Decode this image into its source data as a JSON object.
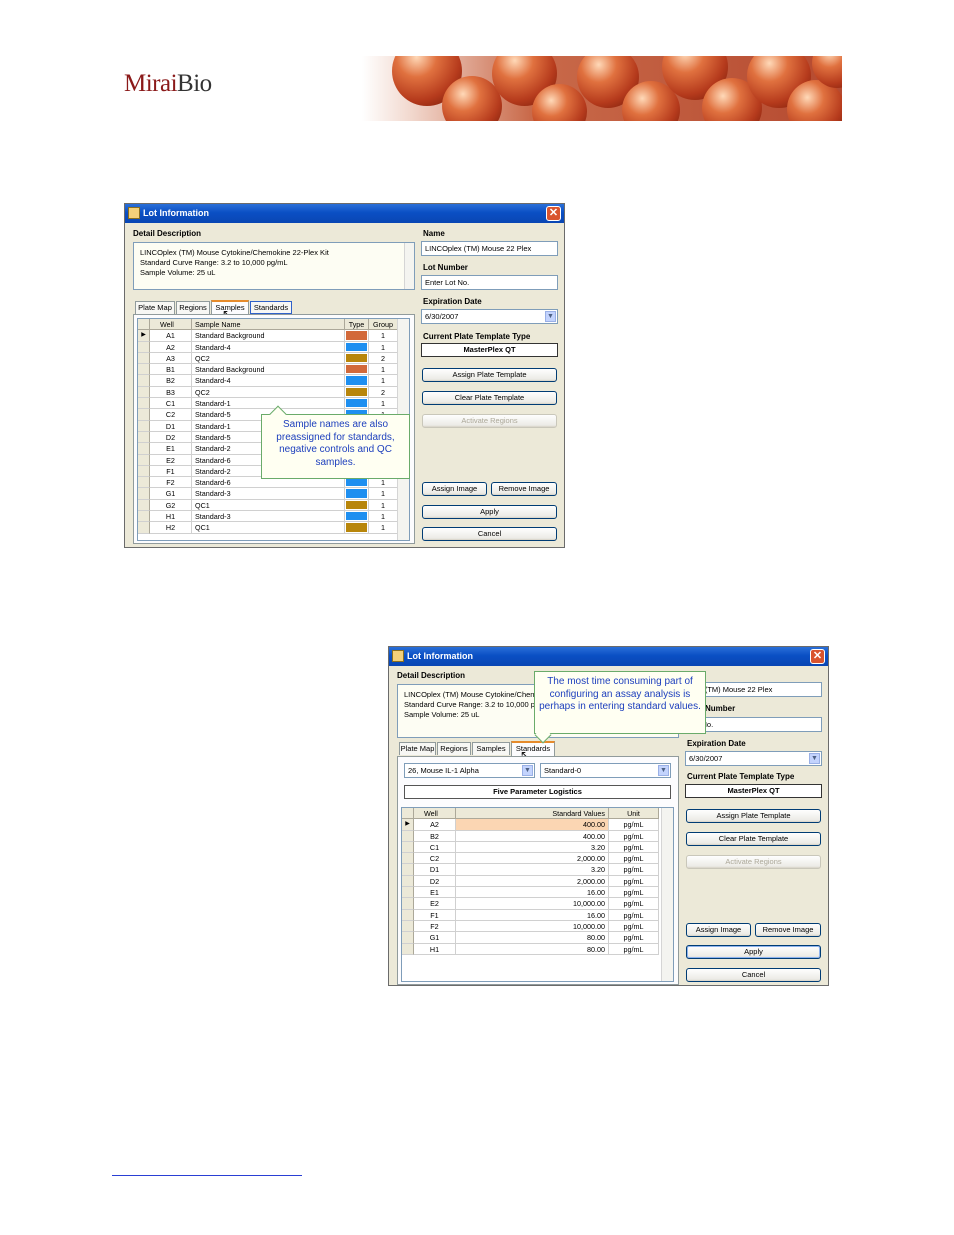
{
  "header": {
    "logo_mirai": "Mirai",
    "logo_bio": "Bio"
  },
  "dialog1": {
    "title": "Lot Information",
    "detail_label": "Detail Description",
    "description_lines": [
      "LINCOplex (TM) Mouse Cytokine/Chemokine 22-Plex Kit",
      "Standard Curve Range: 3.2 to 10,000 pg/mL",
      "Sample Volume: 25 uL"
    ],
    "tabs": [
      "Plate Map",
      "Regions",
      "Samples",
      "Standards"
    ],
    "active_tab": "Samples",
    "columns": [
      "Well",
      "Sample Name",
      "Type",
      "Group"
    ],
    "rows": [
      {
        "well": "A1",
        "name": "Standard Background",
        "color": "#d2693a",
        "group": "1"
      },
      {
        "well": "A2",
        "name": "Standard-4",
        "color": "#1e8ff0",
        "group": "1"
      },
      {
        "well": "A3",
        "name": "QC2",
        "color": "#b8860b",
        "group": "2"
      },
      {
        "well": "B1",
        "name": "Standard Background",
        "color": "#d2693a",
        "group": "1"
      },
      {
        "well": "B2",
        "name": "Standard-4",
        "color": "#1e8ff0",
        "group": "1"
      },
      {
        "well": "B3",
        "name": "QC2",
        "color": "#b8860b",
        "group": "2"
      },
      {
        "well": "C1",
        "name": "Standard-1",
        "color": "#1e8ff0",
        "group": "1"
      },
      {
        "well": "C2",
        "name": "Standard-5",
        "color": "#1e8ff0",
        "group": "1"
      },
      {
        "well": "D1",
        "name": "Standard-1",
        "color": "#1e8ff0",
        "group": "1"
      },
      {
        "well": "D2",
        "name": "Standard-5",
        "color": "#1e8ff0",
        "group": "1"
      },
      {
        "well": "E1",
        "name": "Standard-2",
        "color": "#1e8ff0",
        "group": "1"
      },
      {
        "well": "E2",
        "name": "Standard-6",
        "color": "#1e8ff0",
        "group": "1"
      },
      {
        "well": "F1",
        "name": "Standard-2",
        "color": "#1e8ff0",
        "group": "1"
      },
      {
        "well": "F2",
        "name": "Standard-6",
        "color": "#1e8ff0",
        "group": "1"
      },
      {
        "well": "G1",
        "name": "Standard-3",
        "color": "#1e8ff0",
        "group": "1"
      },
      {
        "well": "G2",
        "name": "QC1",
        "color": "#b8860b",
        "group": "1"
      },
      {
        "well": "H1",
        "name": "Standard-3",
        "color": "#1e8ff0",
        "group": "1"
      },
      {
        "well": "H2",
        "name": "QC1",
        "color": "#b8860b",
        "group": "1"
      }
    ],
    "name_label": "Name",
    "name_value": "LINCOplex (TM) Mouse 22 Plex",
    "lot_label": "Lot Number",
    "lot_value": "Enter Lot No.",
    "exp_label": "Expiration Date",
    "exp_value": "6/30/2007",
    "tpl_label": "Current Plate Template Type",
    "tpl_value": "MasterPlex QT",
    "btn_assign_tpl": "Assign Plate Template",
    "btn_clear_tpl": "Clear Plate Template",
    "btn_activate": "Activate Regions",
    "btn_assign_img": "Assign Image",
    "btn_remove_img": "Remove Image",
    "btn_apply": "Apply",
    "btn_cancel": "Cancel",
    "callout": "Sample names are also preassigned for standards, negative controls and QC samples."
  },
  "dialog2": {
    "title": "Lot Information",
    "detail_label": "Detail Description",
    "description_lines": [
      "LINCOplex (TM) Mouse Cytokine/Chem",
      "Standard Curve Range: 3.2 to 10,000 p",
      "Sample Volume: 25 uL"
    ],
    "tabs": [
      "Plate Map",
      "Regions",
      "Samples",
      "Standards"
    ],
    "active_tab": "Standards",
    "analyte_value": "26, Mouse IL-1 Alpha",
    "standard_value": "Standard-0",
    "curve_value": "Five Parameter Logistics",
    "columns": [
      "Well",
      "Standard Values",
      "Unit"
    ],
    "rows": [
      {
        "well": "A2",
        "value": "400.00",
        "unit": "pg/mL"
      },
      {
        "well": "B2",
        "value": "400.00",
        "unit": "pg/mL"
      },
      {
        "well": "C1",
        "value": "3.20",
        "unit": "pg/mL"
      },
      {
        "well": "C2",
        "value": "2,000.00",
        "unit": "pg/mL"
      },
      {
        "well": "D1",
        "value": "3.20",
        "unit": "pg/mL"
      },
      {
        "well": "D2",
        "value": "2,000.00",
        "unit": "pg/mL"
      },
      {
        "well": "E1",
        "value": "16.00",
        "unit": "pg/mL"
      },
      {
        "well": "E2",
        "value": "10,000.00",
        "unit": "pg/mL"
      },
      {
        "well": "F1",
        "value": "16.00",
        "unit": "pg/mL"
      },
      {
        "well": "F2",
        "value": "10,000.00",
        "unit": "pg/mL"
      },
      {
        "well": "G1",
        "value": "80.00",
        "unit": "pg/mL"
      },
      {
        "well": "H1",
        "value": "80.00",
        "unit": "pg/mL"
      }
    ],
    "name_label_partial": "e",
    "name_value": "plex (TM) Mouse 22 Plex",
    "lot_label": "Number",
    "lot_value": "Lot No.",
    "exp_label": "Expiration Date",
    "exp_value": "6/30/2007",
    "tpl_label": "Current Plate Template Type",
    "tpl_value": "MasterPlex QT",
    "btn_assign_tpl": "Assign Plate Template",
    "btn_clear_tpl": "Clear Plate Template",
    "btn_activate": "Activate Regions",
    "btn_assign_img": "Assign Image",
    "btn_remove_img": "Remove Image",
    "btn_apply": "Apply",
    "btn_cancel": "Cancel",
    "callout": "The most time consuming part of configuring an assay analysis is perhaps in entering standard values."
  }
}
